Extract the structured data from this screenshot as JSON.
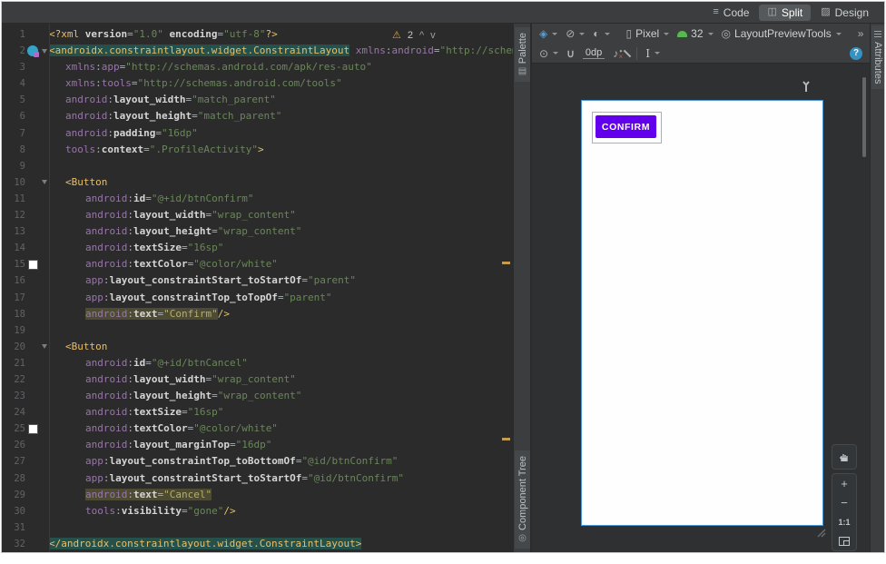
{
  "mode_tabs": [
    {
      "id": "code",
      "label": "Code",
      "icon": "≡",
      "active": false
    },
    {
      "id": "split",
      "label": "Split",
      "icon": "◫",
      "active": true
    },
    {
      "id": "design",
      "label": "Design",
      "icon": "▨",
      "active": false
    }
  ],
  "editor": {
    "inspection": {
      "warning_icon": "⚠",
      "warning_count": "2",
      "up": "^",
      "down": "v"
    },
    "lines": [
      {
        "n": "1",
        "i": 0,
        "s": [
          [
            "<?xml ",
            "t"
          ],
          [
            "version",
            "a"
          ],
          [
            "=",
            "p"
          ],
          [
            "\"1.0\"",
            "v"
          ],
          [
            " ",
            "p"
          ],
          [
            "encoding",
            "a"
          ],
          [
            "=",
            "p"
          ],
          [
            "\"utf-8\"",
            "v"
          ],
          [
            "?>",
            "t"
          ]
        ]
      },
      {
        "n": "2",
        "i": 0,
        "m": "class",
        "f": true,
        "s": [
          [
            "<androidx.constraintlayout.widget.ConstraintLayout",
            "t",
            "T"
          ],
          [
            " ",
            "p"
          ],
          [
            "xmlns",
            "n"
          ],
          [
            ":",
            "p"
          ],
          [
            "android",
            "n"
          ],
          [
            "=",
            "p"
          ],
          [
            "\"http://schem",
            "v"
          ]
        ]
      },
      {
        "n": "3",
        "i": 1,
        "s": [
          [
            "xmlns",
            "n"
          ],
          [
            ":",
            "p"
          ],
          [
            "app",
            "n"
          ],
          [
            "=",
            "p"
          ],
          [
            "\"http://schemas.android.com/apk/res-auto\"",
            "v"
          ]
        ]
      },
      {
        "n": "4",
        "i": 1,
        "s": [
          [
            "xmlns",
            "n"
          ],
          [
            ":",
            "p"
          ],
          [
            "tools",
            "n"
          ],
          [
            "=",
            "p"
          ],
          [
            "\"http://schemas.android.com/tools\"",
            "v"
          ]
        ]
      },
      {
        "n": "5",
        "i": 1,
        "s": [
          [
            "android",
            "n"
          ],
          [
            ":",
            "p"
          ],
          [
            "layout_width",
            "a"
          ],
          [
            "=",
            "p"
          ],
          [
            "\"match_parent\"",
            "v"
          ]
        ]
      },
      {
        "n": "6",
        "i": 1,
        "s": [
          [
            "android",
            "n"
          ],
          [
            ":",
            "p"
          ],
          [
            "layout_height",
            "a"
          ],
          [
            "=",
            "p"
          ],
          [
            "\"match_parent\"",
            "v"
          ]
        ]
      },
      {
        "n": "7",
        "i": 1,
        "s": [
          [
            "android",
            "n"
          ],
          [
            ":",
            "p"
          ],
          [
            "padding",
            "a"
          ],
          [
            "=",
            "p"
          ],
          [
            "\"16dp\"",
            "v"
          ]
        ]
      },
      {
        "n": "8",
        "i": 1,
        "s": [
          [
            "tools",
            "n"
          ],
          [
            ":",
            "p"
          ],
          [
            "context",
            "a"
          ],
          [
            "=",
            "p"
          ],
          [
            "\".ProfileActivity\"",
            "v"
          ],
          [
            ">",
            "t"
          ]
        ]
      },
      {
        "n": "9",
        "i": 0,
        "s": []
      },
      {
        "n": "10",
        "i": 1,
        "f": true,
        "s": [
          [
            "<Button",
            "t"
          ]
        ]
      },
      {
        "n": "11",
        "i": 2,
        "s": [
          [
            "android",
            "n"
          ],
          [
            ":",
            "p"
          ],
          [
            "id",
            "a"
          ],
          [
            "=",
            "p"
          ],
          [
            "\"@+id/btnConfirm\"",
            "v"
          ]
        ]
      },
      {
        "n": "12",
        "i": 2,
        "s": [
          [
            "android",
            "n"
          ],
          [
            ":",
            "p"
          ],
          [
            "layout_width",
            "a"
          ],
          [
            "=",
            "p"
          ],
          [
            "\"wrap_content\"",
            "v"
          ]
        ]
      },
      {
        "n": "13",
        "i": 2,
        "s": [
          [
            "android",
            "n"
          ],
          [
            ":",
            "p"
          ],
          [
            "layout_height",
            "a"
          ],
          [
            "=",
            "p"
          ],
          [
            "\"wrap_content\"",
            "v"
          ]
        ]
      },
      {
        "n": "14",
        "i": 2,
        "s": [
          [
            "android",
            "n"
          ],
          [
            ":",
            "p"
          ],
          [
            "textSize",
            "a"
          ],
          [
            "=",
            "p"
          ],
          [
            "\"16sp\"",
            "v"
          ]
        ]
      },
      {
        "n": "15",
        "i": 2,
        "m": "swatch",
        "s": [
          [
            "android",
            "n"
          ],
          [
            ":",
            "p"
          ],
          [
            "textColor",
            "a"
          ],
          [
            "=",
            "p"
          ],
          [
            "\"@color/white\"",
            "v"
          ]
        ]
      },
      {
        "n": "16",
        "i": 2,
        "s": [
          [
            "app",
            "n"
          ],
          [
            ":",
            "p"
          ],
          [
            "layout_constraintStart_toStartOf",
            "a"
          ],
          [
            "=",
            "p"
          ],
          [
            "\"parent\"",
            "v"
          ]
        ]
      },
      {
        "n": "17",
        "i": 2,
        "s": [
          [
            "app",
            "n"
          ],
          [
            ":",
            "p"
          ],
          [
            "layout_constraintTop_toTopOf",
            "a"
          ],
          [
            "=",
            "p"
          ],
          [
            "\"parent\"",
            "v"
          ]
        ]
      },
      {
        "n": "18",
        "i": 2,
        "s": [
          [
            "android",
            "n",
            "O"
          ],
          [
            ":",
            "p",
            "O"
          ],
          [
            "text",
            "a",
            "O"
          ],
          [
            "=",
            "p",
            "O"
          ],
          [
            "\"Confirm\"",
            "v",
            "O"
          ],
          [
            "/>",
            "t"
          ]
        ]
      },
      {
        "n": "19",
        "i": 0,
        "s": []
      },
      {
        "n": "20",
        "i": 1,
        "f": true,
        "s": [
          [
            "<Button",
            "t"
          ]
        ]
      },
      {
        "n": "21",
        "i": 2,
        "s": [
          [
            "android",
            "n"
          ],
          [
            ":",
            "p"
          ],
          [
            "id",
            "a"
          ],
          [
            "=",
            "p"
          ],
          [
            "\"@+id/btnCancel\"",
            "v"
          ]
        ]
      },
      {
        "n": "22",
        "i": 2,
        "s": [
          [
            "android",
            "n"
          ],
          [
            ":",
            "p"
          ],
          [
            "layout_width",
            "a"
          ],
          [
            "=",
            "p"
          ],
          [
            "\"wrap_content\"",
            "v"
          ]
        ]
      },
      {
        "n": "23",
        "i": 2,
        "s": [
          [
            "android",
            "n"
          ],
          [
            ":",
            "p"
          ],
          [
            "layout_height",
            "a"
          ],
          [
            "=",
            "p"
          ],
          [
            "\"wrap_content\"",
            "v"
          ]
        ]
      },
      {
        "n": "24",
        "i": 2,
        "s": [
          [
            "android",
            "n"
          ],
          [
            ":",
            "p"
          ],
          [
            "textSize",
            "a"
          ],
          [
            "=",
            "p"
          ],
          [
            "\"16sp\"",
            "v"
          ]
        ]
      },
      {
        "n": "25",
        "i": 2,
        "m": "swatch",
        "s": [
          [
            "android",
            "n"
          ],
          [
            ":",
            "p"
          ],
          [
            "textColor",
            "a"
          ],
          [
            "=",
            "p"
          ],
          [
            "\"@color/white\"",
            "v"
          ]
        ]
      },
      {
        "n": "26",
        "i": 2,
        "s": [
          [
            "android",
            "n"
          ],
          [
            ":",
            "p"
          ],
          [
            "layout_marginTop",
            "a"
          ],
          [
            "=",
            "p"
          ],
          [
            "\"16dp\"",
            "v"
          ]
        ]
      },
      {
        "n": "27",
        "i": 2,
        "s": [
          [
            "app",
            "n"
          ],
          [
            ":",
            "p"
          ],
          [
            "layout_constraintTop_toBottomOf",
            "a"
          ],
          [
            "=",
            "p"
          ],
          [
            "\"@id/btnConfirm\"",
            "v"
          ]
        ]
      },
      {
        "n": "28",
        "i": 2,
        "s": [
          [
            "app",
            "n"
          ],
          [
            ":",
            "p"
          ],
          [
            "layout_constraintStart_toStartOf",
            "a"
          ],
          [
            "=",
            "p"
          ],
          [
            "\"@id/btnConfirm\"",
            "v"
          ]
        ]
      },
      {
        "n": "29",
        "i": 2,
        "s": [
          [
            "android",
            "n",
            "O"
          ],
          [
            ":",
            "p",
            "O"
          ],
          [
            "text",
            "a",
            "O"
          ],
          [
            "=",
            "p",
            "O"
          ],
          [
            "\"Cancel\"",
            "v",
            "O"
          ]
        ]
      },
      {
        "n": "30",
        "i": 2,
        "s": [
          [
            "tools",
            "n"
          ],
          [
            ":",
            "p"
          ],
          [
            "visibility",
            "a"
          ],
          [
            "=",
            "p"
          ],
          [
            "\"gone\"",
            "v"
          ],
          [
            "/>",
            "t"
          ]
        ]
      },
      {
        "n": "31",
        "i": 0,
        "s": []
      },
      {
        "n": "32",
        "i": 0,
        "s": [
          [
            "</androidx.constraintlayout.widget.ConstraintLayout>",
            "t",
            "T"
          ]
        ]
      }
    ]
  },
  "tool_windows": {
    "palette": "Palette",
    "component_tree": "Component Tree",
    "attributes": "Attributes"
  },
  "icons": {
    "layers": "◈",
    "orientation": "⊘",
    "night": "◐",
    "device": "▯",
    "theme": "◎",
    "overflow": "»",
    "warning": "⚠",
    "eye": "⊙",
    "magnet": "∪",
    "note": "♪",
    "ibeam": "I",
    "help": "?",
    "palette": "▤",
    "tree": "◎"
  },
  "design": {
    "toolbar": {
      "device": "Pixel",
      "api": "32",
      "theme": "LayoutPreviewTools",
      "margin": "0dp"
    },
    "preview": {
      "button_label": "CONFIRM",
      "button_color": "#6200EE"
    },
    "zoom": {
      "zoom_in": "+",
      "zoom_out": "−",
      "one_to_one": "1:1"
    }
  }
}
